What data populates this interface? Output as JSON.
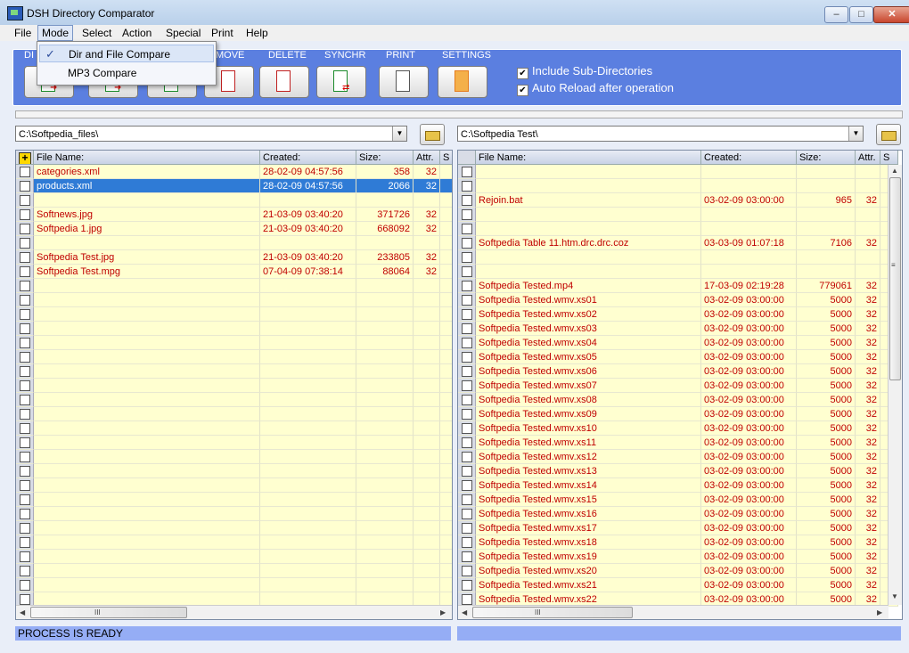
{
  "window": {
    "title": "DSH Directory Comparator"
  },
  "menu": [
    "File",
    "Mode",
    "Select",
    "Action",
    "Special",
    "Print",
    "Help"
  ],
  "mode_menu": {
    "items": [
      "Dir and File Compare",
      "MP3 Compare"
    ],
    "checked_index": 0
  },
  "toolbar": {
    "labels": {
      "di": "DI",
      "move": "MOVE",
      "delete": "DELETE",
      "synchr": "SYNCHR",
      "print": "PRINT",
      "settings": "SETTINGS"
    },
    "options": [
      {
        "label": "Include Sub-Directories",
        "checked": true
      },
      {
        "label": "Auto Reload after operation",
        "checked": true
      }
    ]
  },
  "left": {
    "path": "C:\\Softpedia_files\\",
    "columns": [
      "File Name:",
      "Created:",
      "Size:",
      "Attr.",
      "S"
    ],
    "rows": [
      {
        "name": "categories.xml",
        "created": "28-02-09 04:57:56",
        "size": "358",
        "attr": "32"
      },
      {
        "name": "products.xml",
        "created": "28-02-09 04:57:56",
        "size": "2066",
        "attr": "32",
        "selected": true
      },
      {
        "name": "",
        "created": "",
        "size": "",
        "attr": ""
      },
      {
        "name": "Softnews.jpg",
        "created": "21-03-09 03:40:20",
        "size": "371726",
        "attr": "32"
      },
      {
        "name": "Softpedia 1.jpg",
        "created": "21-03-09 03:40:20",
        "size": "668092",
        "attr": "32"
      },
      {
        "name": "",
        "created": "",
        "size": "",
        "attr": ""
      },
      {
        "name": "Softpedia Test.jpg",
        "created": "21-03-09 03:40:20",
        "size": "233805",
        "attr": "32"
      },
      {
        "name": "Softpedia Test.mpg",
        "created": "07-04-09 07:38:14",
        "size": "88064",
        "attr": "32"
      }
    ],
    "status": "PROCESS IS READY"
  },
  "right": {
    "path": "C:\\Softpedia Test\\",
    "columns": [
      "File Name:",
      "Created:",
      "Size:",
      "Attr.",
      "S"
    ],
    "rows": [
      {
        "name": "",
        "created": "",
        "size": "",
        "attr": ""
      },
      {
        "name": "",
        "created": "",
        "size": "",
        "attr": ""
      },
      {
        "name": "Rejoin.bat",
        "created": "03-02-09 03:00:00",
        "size": "965",
        "attr": "32"
      },
      {
        "name": "",
        "created": "",
        "size": "",
        "attr": ""
      },
      {
        "name": "",
        "created": "",
        "size": "",
        "attr": ""
      },
      {
        "name": "Softpedia Table 11.htm.drc.drc.coz",
        "created": "03-03-09 01:07:18",
        "size": "7106",
        "attr": "32"
      },
      {
        "name": "",
        "created": "",
        "size": "",
        "attr": ""
      },
      {
        "name": "",
        "created": "",
        "size": "",
        "attr": ""
      },
      {
        "name": "Softpedia Tested.mp4",
        "created": "17-03-09 02:19:28",
        "size": "779061",
        "attr": "32"
      },
      {
        "name": "Softpedia Tested.wmv.xs01",
        "created": "03-02-09 03:00:00",
        "size": "5000",
        "attr": "32"
      },
      {
        "name": "Softpedia Tested.wmv.xs02",
        "created": "03-02-09 03:00:00",
        "size": "5000",
        "attr": "32"
      },
      {
        "name": "Softpedia Tested.wmv.xs03",
        "created": "03-02-09 03:00:00",
        "size": "5000",
        "attr": "32"
      },
      {
        "name": "Softpedia Tested.wmv.xs04",
        "created": "03-02-09 03:00:00",
        "size": "5000",
        "attr": "32"
      },
      {
        "name": "Softpedia Tested.wmv.xs05",
        "created": "03-02-09 03:00:00",
        "size": "5000",
        "attr": "32"
      },
      {
        "name": "Softpedia Tested.wmv.xs06",
        "created": "03-02-09 03:00:00",
        "size": "5000",
        "attr": "32"
      },
      {
        "name": "Softpedia Tested.wmv.xs07",
        "created": "03-02-09 03:00:00",
        "size": "5000",
        "attr": "32"
      },
      {
        "name": "Softpedia Tested.wmv.xs08",
        "created": "03-02-09 03:00:00",
        "size": "5000",
        "attr": "32"
      },
      {
        "name": "Softpedia Tested.wmv.xs09",
        "created": "03-02-09 03:00:00",
        "size": "5000",
        "attr": "32"
      },
      {
        "name": "Softpedia Tested.wmv.xs10",
        "created": "03-02-09 03:00:00",
        "size": "5000",
        "attr": "32"
      },
      {
        "name": "Softpedia Tested.wmv.xs11",
        "created": "03-02-09 03:00:00",
        "size": "5000",
        "attr": "32"
      },
      {
        "name": "Softpedia Tested.wmv.xs12",
        "created": "03-02-09 03:00:00",
        "size": "5000",
        "attr": "32"
      },
      {
        "name": "Softpedia Tested.wmv.xs13",
        "created": "03-02-09 03:00:00",
        "size": "5000",
        "attr": "32"
      },
      {
        "name": "Softpedia Tested.wmv.xs14",
        "created": "03-02-09 03:00:00",
        "size": "5000",
        "attr": "32"
      },
      {
        "name": "Softpedia Tested.wmv.xs15",
        "created": "03-02-09 03:00:00",
        "size": "5000",
        "attr": "32"
      },
      {
        "name": "Softpedia Tested.wmv.xs16",
        "created": "03-02-09 03:00:00",
        "size": "5000",
        "attr": "32"
      },
      {
        "name": "Softpedia Tested.wmv.xs17",
        "created": "03-02-09 03:00:00",
        "size": "5000",
        "attr": "32"
      },
      {
        "name": "Softpedia Tested.wmv.xs18",
        "created": "03-02-09 03:00:00",
        "size": "5000",
        "attr": "32"
      },
      {
        "name": "Softpedia Tested.wmv.xs19",
        "created": "03-02-09 03:00:00",
        "size": "5000",
        "attr": "32"
      },
      {
        "name": "Softpedia Tested.wmv.xs20",
        "created": "03-02-09 03:00:00",
        "size": "5000",
        "attr": "32"
      },
      {
        "name": "Softpedia Tested.wmv.xs21",
        "created": "03-02-09 03:00:00",
        "size": "5000",
        "attr": "32"
      },
      {
        "name": "Softpedia Tested.wmv.xs22",
        "created": "03-02-09 03:00:00",
        "size": "5000",
        "attr": "32"
      }
    ],
    "status": ""
  },
  "colors": {
    "toolbar": "#5b7fe0",
    "status": "#95adf5",
    "row_text": "#c00000",
    "row_bg": "#ffffd0",
    "selected": "#2f7bd6"
  },
  "scroll_glyphs": {
    "left": "◀",
    "right": "▶",
    "up": "▲",
    "down": "▼",
    "grip_h": "III",
    "grip_v": "≡"
  }
}
